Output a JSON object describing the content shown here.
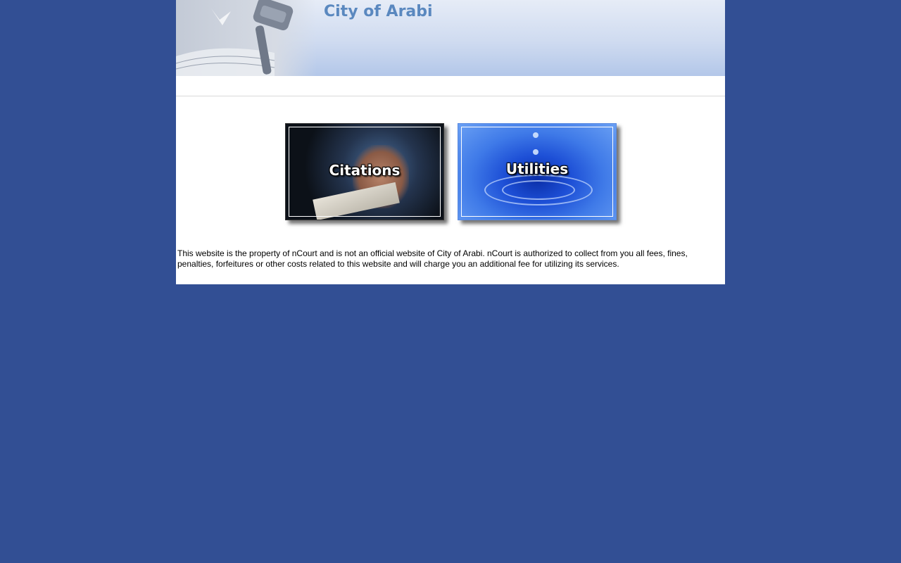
{
  "header": {
    "title": "City of Arabi"
  },
  "tiles": [
    {
      "label": "Citations"
    },
    {
      "label": "Utilities"
    }
  ],
  "disclaimer": {
    "text": "This website is the property of nCourt and is not an official website of City of Arabi. nCourt is authorized to collect from you all fees, fines, penalties, forfeitures or other costs related to this website and will charge you an additional fee for utilizing its services."
  },
  "colors": {
    "background": "#324f94",
    "title": "#5a88bf",
    "content": "#ffffff"
  },
  "icons": {
    "header_art": "gavel-icon"
  }
}
